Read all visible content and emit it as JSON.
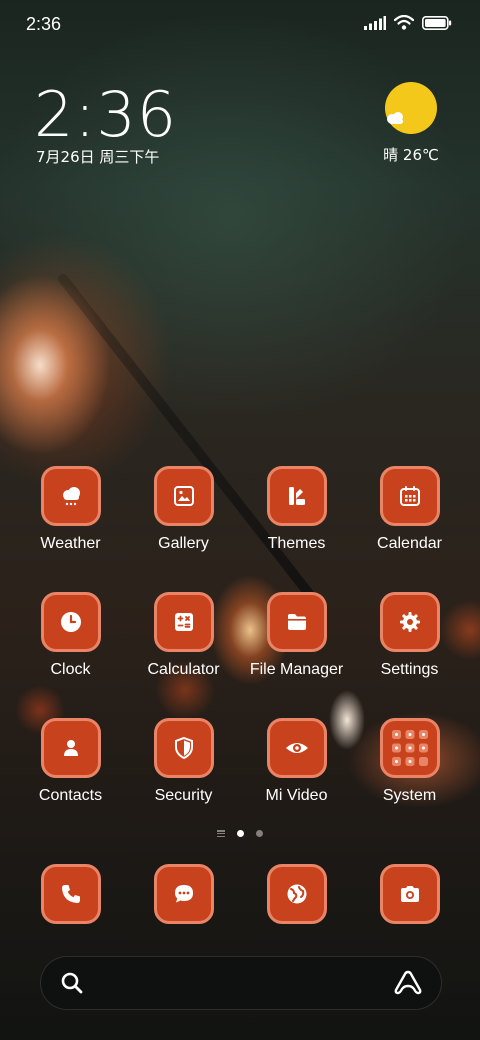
{
  "status_bar": {
    "time": "2:36",
    "icons": [
      "signal-icon",
      "wifi-icon",
      "battery-icon"
    ]
  },
  "lockclock": {
    "time": "2:36",
    "date": "7月26日 周三下午"
  },
  "weather": {
    "condition_icon": "sunny-cloud-icon",
    "text": "晴 26℃"
  },
  "apps": [
    {
      "label": "Weather",
      "icon": "weather-icon"
    },
    {
      "label": "Gallery",
      "icon": "gallery-icon"
    },
    {
      "label": "Themes",
      "icon": "themes-icon"
    },
    {
      "label": "Calendar",
      "icon": "calendar-icon"
    },
    {
      "label": "Clock",
      "icon": "clock-icon"
    },
    {
      "label": "Calculator",
      "icon": "calculator-icon"
    },
    {
      "label": "File Manager",
      "icon": "folder-icon"
    },
    {
      "label": "Settings",
      "icon": "gear-icon"
    },
    {
      "label": "Contacts",
      "icon": "contacts-icon"
    },
    {
      "label": "Security",
      "icon": "shield-icon"
    },
    {
      "label": "Mi Video",
      "icon": "eye-icon"
    },
    {
      "label": "System",
      "icon": "folder-grid-icon"
    }
  ],
  "page_indicator": {
    "pages": 2,
    "current": 1
  },
  "dock": [
    {
      "icon": "phone-icon"
    },
    {
      "icon": "message-icon"
    },
    {
      "icon": "browser-icon"
    },
    {
      "icon": "camera-icon"
    }
  ],
  "search": {
    "icon": "search-icon",
    "assistant_icon": "ai-assistant-icon"
  },
  "colors": {
    "icon_bg": "#c8431d",
    "icon_border": "#e98566",
    "sun": "#f4c81b"
  }
}
